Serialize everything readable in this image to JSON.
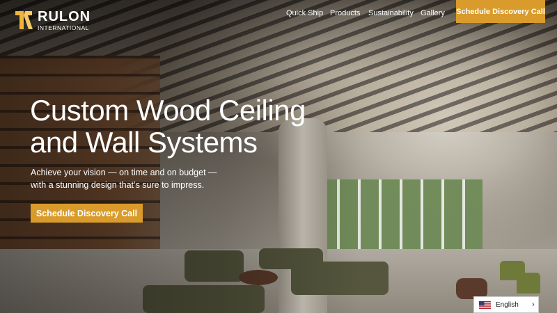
{
  "brand": {
    "name": "RULON",
    "sub": "INTERNATIONAL",
    "colors": {
      "accent": "#d99b2b",
      "logo_gold": "#f0b43a"
    }
  },
  "nav": {
    "items": [
      {
        "label": "Quick Ship"
      },
      {
        "label": "Products"
      },
      {
        "label": "Sustainability"
      },
      {
        "label": "Gallery"
      }
    ],
    "cta_label": "Schedule Discovery Call"
  },
  "hero": {
    "title_line1": "Custom Wood Ceiling",
    "title_line2": "and Wall Systems",
    "subtitle_line1": "Achieve your vision — on time and on budget —",
    "subtitle_line2": "with a stunning design that’s sure to impress.",
    "cta_label": "Schedule Discovery Call"
  },
  "language": {
    "selected": "English",
    "flag_icon": "us-flag-icon",
    "chevron_icon": "chevron-right-icon"
  }
}
